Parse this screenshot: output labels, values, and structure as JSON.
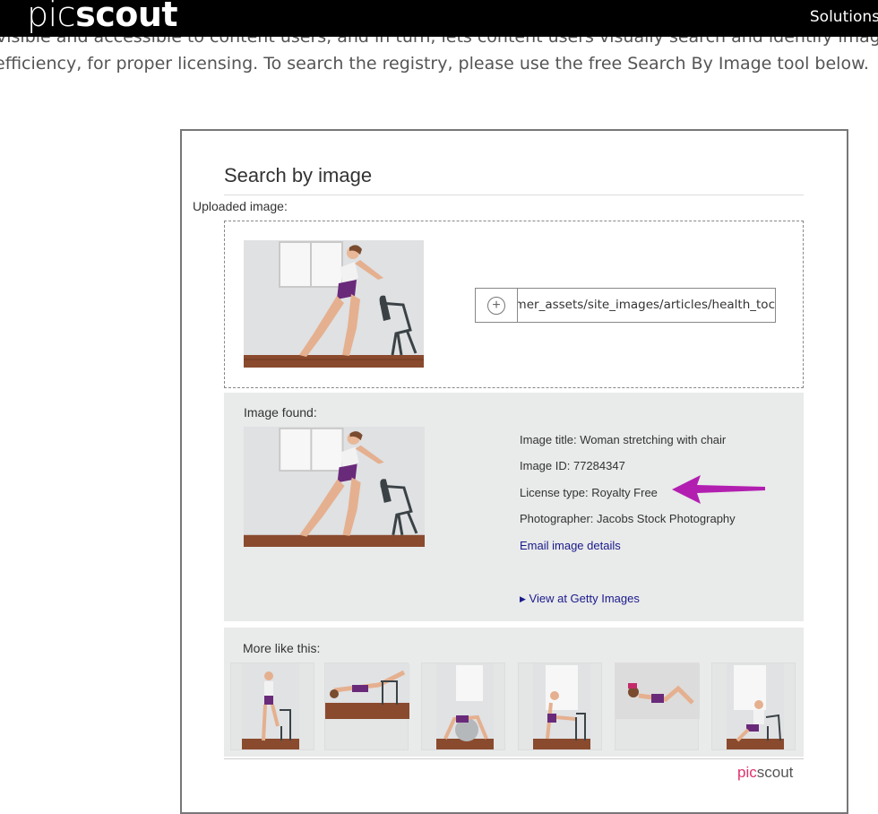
{
  "header": {
    "logo_pic": "pic",
    "logo_scout": "scout",
    "nav_item": "Solutions"
  },
  "intro": {
    "line1": "visible and accessible to content users, and in turn, lets content users visually search and identify images",
    "line2": "efficiency, for proper licensing. To search the registry, please use the free Search By Image tool below."
  },
  "widget": {
    "title": "Search by image",
    "uploaded_label": "Uploaded image:",
    "url_value": "consumer_assets/site_images/articles/health_toc",
    "found_label": "Image found:",
    "image_title": "Image title: Woman stretching with chair",
    "image_id": "Image ID: 77284347",
    "license_type": "License type: Royalty Free",
    "photographer": "Photographer: Jacobs Stock Photography",
    "email_link": "Email image details",
    "view_link": "View at Getty Images",
    "more_label": "More like this:",
    "footer_pic": "pic",
    "footer_scout": "scout"
  },
  "colors": {
    "arrow": "#b21fb0",
    "link": "#1a1a8c",
    "panel": "#e9eaea"
  }
}
